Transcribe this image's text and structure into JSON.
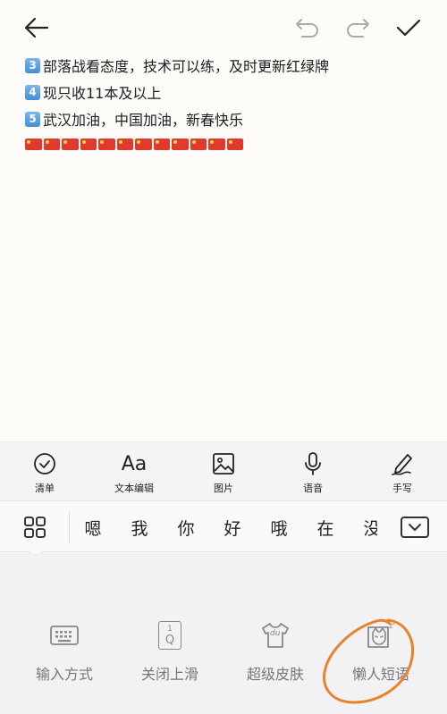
{
  "header": {
    "back_icon": "arrow-left-icon",
    "undo_icon": "undo-icon",
    "redo_icon": "redo-icon",
    "confirm_icon": "checkmark-icon"
  },
  "note": {
    "lines": [
      {
        "badge": "3",
        "text": "部落战看态度，技术可以练，及时更新红绿牌"
      },
      {
        "badge": "4",
        "text": "现只收11本及以上"
      },
      {
        "badge": "5",
        "text": "武汉加油，中国加油，新春快乐"
      }
    ],
    "flag_count": 12,
    "flag_color": "#e03a2e"
  },
  "toolbar": {
    "items": [
      {
        "label": "清单",
        "icon": "checklist-icon"
      },
      {
        "label": "文本编辑",
        "icon": "text-format-icon",
        "glyph": "Aa"
      },
      {
        "label": "图片",
        "icon": "image-icon"
      },
      {
        "label": "语音",
        "icon": "microphone-icon"
      },
      {
        "label": "手写",
        "icon": "handwriting-pen-icon"
      }
    ]
  },
  "candidates": {
    "menu_icon": "grid-menu-icon",
    "words": [
      "嗯",
      "我",
      "你",
      "好",
      "哦",
      "在",
      "没"
    ],
    "collapse_icon": "keyboard-collapse-icon"
  },
  "panel": {
    "items": [
      {
        "label": "输入方式",
        "icon": "keyboard-icon"
      },
      {
        "label": "关闭上滑",
        "icon": "swipe-up-q-icon",
        "glyph_top": "1",
        "glyph_bottom": "Q"
      },
      {
        "label": "超级皮肤",
        "icon": "tshirt-skin-icon",
        "glyph": "du"
      },
      {
        "label": "懒人短语",
        "icon": "lazy-cat-phrases-icon"
      }
    ],
    "highlight_color": "#e8832a"
  }
}
